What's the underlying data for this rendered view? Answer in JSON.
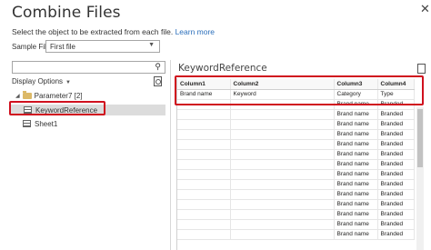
{
  "dialog": {
    "title": "Combine Files",
    "subtitle": "Select the object to be extracted from each file.",
    "learn_more": "Learn more"
  },
  "sample": {
    "label": "Sample File:",
    "value": "First file"
  },
  "left": {
    "display_options": "Display Options",
    "parameter": "Parameter7 [2]",
    "items": [
      "KeywordReference",
      "Sheet1"
    ]
  },
  "preview": {
    "title": "KeywordReference",
    "headers": [
      "Column1",
      "Column2",
      "Column3",
      "Column4"
    ],
    "first_row": [
      "Brand name",
      "Keyword",
      "Category",
      "Type"
    ],
    "rows": [
      [
        "",
        "",
        "Brand name",
        "Branded"
      ],
      [
        "",
        "",
        "Brand name",
        "Branded"
      ],
      [
        "",
        "",
        "Brand name",
        "Branded"
      ],
      [
        "",
        "",
        "Brand name",
        "Branded"
      ],
      [
        "",
        "",
        "Brand name",
        "Branded"
      ],
      [
        "",
        "",
        "Brand name",
        "Branded"
      ],
      [
        "",
        "",
        "Brand name",
        "Branded"
      ],
      [
        "",
        "",
        "Brand name",
        "Branded"
      ],
      [
        "",
        "",
        "Brand name",
        "Branded"
      ],
      [
        "",
        "",
        "Brand name",
        "Branded"
      ],
      [
        "",
        "",
        "Brand name",
        "Branded"
      ],
      [
        "",
        "",
        "Brand name",
        "Branded"
      ],
      [
        "",
        "",
        "Brand name",
        "Branded"
      ],
      [
        "",
        "",
        "Brand name",
        "Branded"
      ]
    ]
  },
  "colors": {
    "highlight": "#d0101e",
    "link": "#2a6ebb",
    "selection": "#dcdcdc"
  },
  "icons": [
    "close-icon",
    "chevron-down-icon",
    "search-icon",
    "document-refresh-icon",
    "folder-icon",
    "sheet-icon",
    "document-icon"
  ]
}
